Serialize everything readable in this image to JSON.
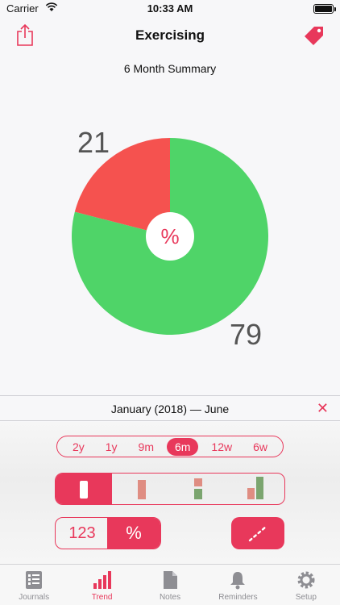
{
  "status": {
    "carrier": "Carrier",
    "time": "10:33 AM"
  },
  "nav": {
    "title": "Exercising"
  },
  "summary_title": "6 Month Summary",
  "chart_data": {
    "type": "pie",
    "values": [
      21,
      79
    ],
    "colors": [
      "#f5524f",
      "#4fd468"
    ],
    "labels": [
      "21",
      "79"
    ],
    "center_label": "%"
  },
  "range": {
    "label": "January (2018) — June",
    "close": "✕"
  },
  "periods": [
    {
      "label": "2y",
      "active": false
    },
    {
      "label": "1y",
      "active": false
    },
    {
      "label": "9m",
      "active": false
    },
    {
      "label": "6m",
      "active": true
    },
    {
      "label": "12w",
      "active": false
    },
    {
      "label": "6w",
      "active": false
    }
  ],
  "modes": {
    "count_label": "123",
    "percent_label": "%"
  },
  "tabs": [
    {
      "label": "Journals",
      "icon": "list-icon"
    },
    {
      "label": "Trend",
      "icon": "chart-bars-icon",
      "active": true
    },
    {
      "label": "Notes",
      "icon": "document-icon"
    },
    {
      "label": "Reminders",
      "icon": "bell-icon"
    },
    {
      "label": "Setup",
      "icon": "gear-icon"
    }
  ],
  "colors": {
    "accent": "#e8385b",
    "red": "#f5524f",
    "green": "#4fd468"
  }
}
